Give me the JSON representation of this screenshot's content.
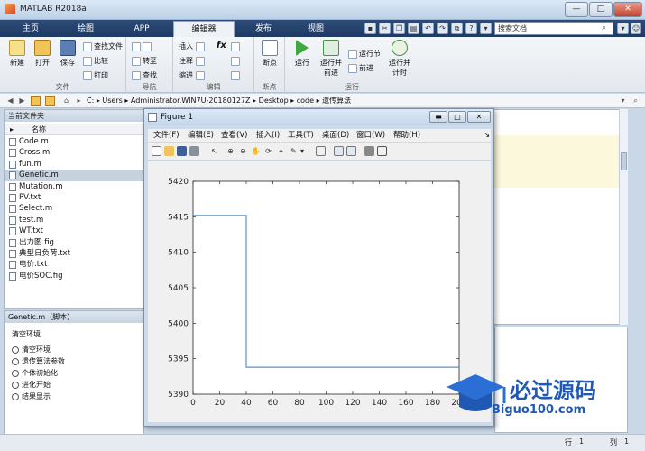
{
  "window": {
    "title": "MATLAB R2018a",
    "controls": [
      "—",
      "□",
      "✕"
    ]
  },
  "tabs": [
    {
      "label": "主页",
      "active": false
    },
    {
      "label": "绘图",
      "active": false
    },
    {
      "label": "APP",
      "active": false
    },
    {
      "label": "编辑器",
      "active": true
    },
    {
      "label": "发布",
      "active": false
    },
    {
      "label": "视图",
      "active": false
    }
  ],
  "search": {
    "placeholder": "搜索文档"
  },
  "ribbon": {
    "file": {
      "label": "文件",
      "new": "新建",
      "open": "打开",
      "save": "保存",
      "find_files": "查找文件",
      "compare": "比较",
      "print": "打印"
    },
    "nav": {
      "label": "导航",
      "goto": "转至",
      "find": "查找"
    },
    "edit": {
      "label": "编辑",
      "insert": "插入",
      "comment": "注释",
      "indent": "缩进",
      "fx": "fx"
    },
    "breakpoint": {
      "label": "断点",
      "breakpoints": "断点"
    },
    "run": {
      "label": "运行",
      "run": "运行",
      "run_advance": "运行并\n前进",
      "run_section": "运行节",
      "advance": "前进",
      "run_time": "运行并\n计时"
    }
  },
  "address": {
    "segments": [
      "C:",
      "Users",
      "Administrator.WIN7U-20180127Z",
      "Desktop",
      "code",
      "遗传算法"
    ]
  },
  "current_folder": {
    "title": "当前文件夹",
    "column": "名称",
    "files": [
      "Code.m",
      "Cross.m",
      "fun.m",
      "Genetic.m",
      "Mutation.m",
      "PV.txt",
      "Select.m",
      "test.m",
      "WT.txt",
      "出力图.fig",
      "典型日负荷.txt",
      "电价.txt",
      "电价SOC.fig"
    ],
    "selected": "Genetic.m"
  },
  "details": {
    "title": "Genetic.m（脚本）",
    "heading": "清空环境",
    "items": [
      "清空环境",
      "遗传算法参数",
      "个体初始化",
      "进化开始",
      "结果显示"
    ]
  },
  "figure": {
    "title": "Figure 1",
    "menu": [
      "文件(F)",
      "编辑(E)",
      "查看(V)",
      "插入(I)",
      "工具(T)",
      "桌面(D)",
      "窗口(W)",
      "帮助(H)"
    ]
  },
  "chart_data": {
    "type": "line",
    "title": "",
    "xlabel": "",
    "ylabel": "",
    "xlim": [
      0,
      200
    ],
    "ylim": [
      5390,
      5420
    ],
    "xticks": [
      0,
      20,
      40,
      60,
      80,
      100,
      120,
      140,
      160,
      180,
      200
    ],
    "yticks": [
      5390,
      5395,
      5400,
      5405,
      5410,
      5415,
      5420
    ],
    "x": [
      0,
      40,
      40,
      200
    ],
    "y": [
      5415.2,
      5415.2,
      5393.8,
      5393.8
    ],
    "color": "#5b8fc9",
    "grid": false
  },
  "statusbar": {
    "row_label": "行",
    "row_value": "1",
    "col_label": "列",
    "col_value": "1"
  },
  "watermark": {
    "brand": "必过源码",
    "url": "Biguo100.com"
  }
}
